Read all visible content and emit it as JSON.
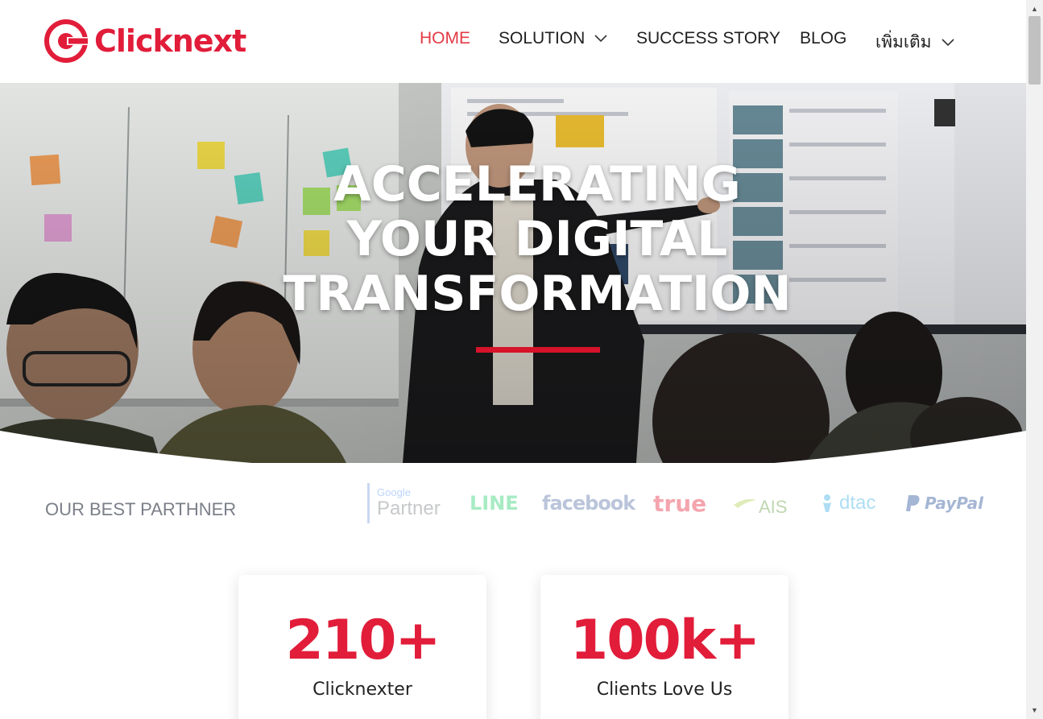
{
  "brand": {
    "name": "Clicknext",
    "color": "#e11d3a",
    "logo_icon": "clicknext-target-logo"
  },
  "nav": {
    "items": [
      {
        "label": "HOME",
        "active": true,
        "has_dropdown": false
      },
      {
        "label": "SOLUTION",
        "active": false,
        "has_dropdown": true
      },
      {
        "label": "SUCCESS STORY",
        "active": false,
        "has_dropdown": false
      },
      {
        "label": "BLOG",
        "active": false,
        "has_dropdown": false
      },
      {
        "label": "เพิ่มเติม",
        "active": false,
        "has_dropdown": true
      }
    ],
    "active_color": "#e33a46"
  },
  "hero": {
    "title_lines": [
      "ACCELERATING",
      "YOUR DIGITAL",
      "TRANSFORMATION"
    ],
    "image": "team-meeting-photo",
    "accent_color": "#d6132a"
  },
  "partners": {
    "label": "OUR BEST PARTHNER",
    "logos": [
      {
        "name": "Google Partner",
        "top": "Google",
        "bottom": "Partner"
      },
      {
        "name": "LINE"
      },
      {
        "name": "facebook"
      },
      {
        "name": "true"
      },
      {
        "name": "AIS"
      },
      {
        "name": "dtac"
      },
      {
        "name": "PayPal"
      }
    ]
  },
  "stats": [
    {
      "value": "210+",
      "label": "Clicknexter"
    },
    {
      "value": "100k+",
      "label": "Clients Love Us"
    }
  ]
}
